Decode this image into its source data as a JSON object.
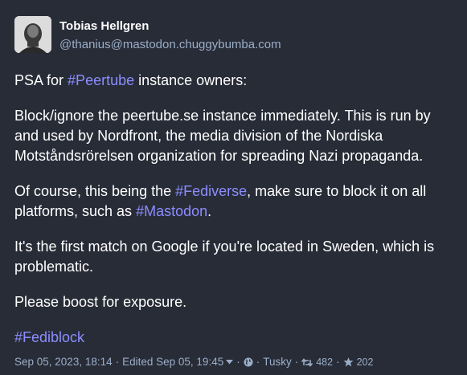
{
  "author": {
    "display_name": "Tobias Hellgren",
    "handle": "@thanius@mastodon.chuggybumba.com"
  },
  "post": {
    "p1": {
      "pre": "PSA for ",
      "tag": "#Peertube",
      "post": " instance owners:"
    },
    "p2": "Block/ignore the peertube.se instance immediately. This is run by and used by Nordfront, the media division of the Nordiska Motståndsrörelsen organization for spreading Nazi propaganda.",
    "p3": {
      "pre": "Of course, this being the ",
      "tag1": "#Fediverse",
      "mid": ", make sure to block it on all platforms, such as ",
      "tag2": "#Mastodon",
      "post": "."
    },
    "p4": "It's the first match on Google if you're located in Sweden, which is problematic.",
    "p5": "Please boost for exposure.",
    "p6_tag": "#Fediblock"
  },
  "meta": {
    "date": "Sep 05, 2023, 18:14",
    "edited": "Edited Sep 05, 19:45",
    "app": "Tusky",
    "boosts": "482",
    "favourites": "202",
    "separator": "·"
  },
  "icons": {
    "edit_dropdown": "chevron-down-icon",
    "visibility": "globe-icon",
    "boost": "retweet-icon",
    "favourite": "star-icon"
  },
  "colors": {
    "background": "#282c37",
    "hashtag": "#8c8dff",
    "meta": "#9baec8"
  }
}
